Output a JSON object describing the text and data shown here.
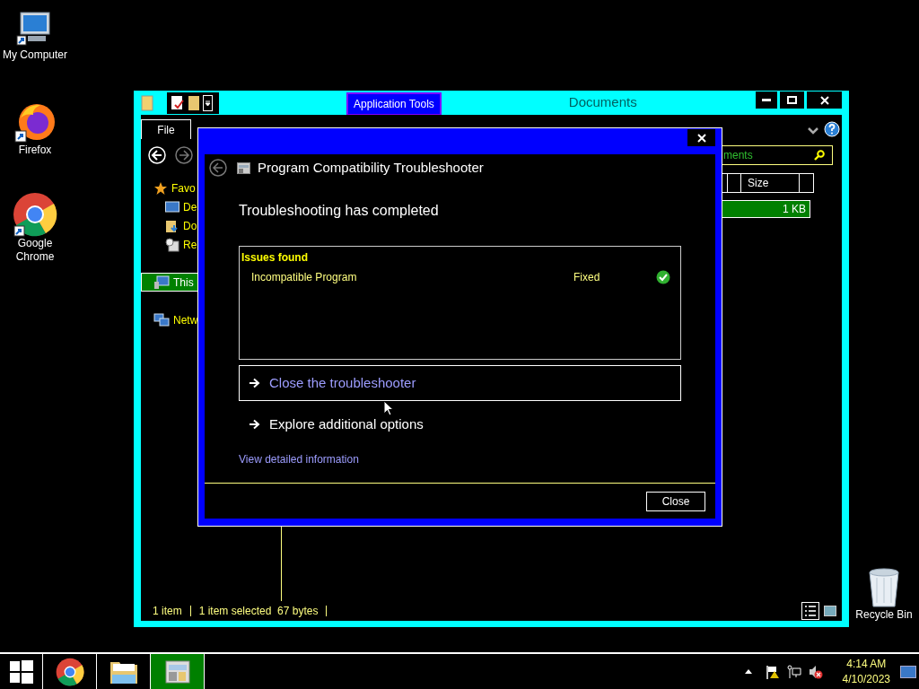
{
  "desktop_icons": [
    {
      "kind": "computer",
      "label": "My Computer"
    },
    {
      "kind": "firefox",
      "label": "Firefox"
    },
    {
      "kind": "chrome",
      "label": "Google Chrome"
    },
    {
      "kind": "recycle",
      "label": "Recycle Bin"
    }
  ],
  "explorer": {
    "title": "Documents",
    "contextual_tab": "Application Tools",
    "file_tab": "File",
    "tree": [
      {
        "kind": "favorites",
        "label": "Favo",
        "selected": false,
        "children": [
          {
            "kind": "desktop",
            "label": "De",
            "selected": false
          },
          {
            "kind": "downloads",
            "label": "Do",
            "selected": false
          },
          {
            "kind": "recent",
            "label": "Re",
            "selected": false
          }
        ]
      },
      {
        "kind": "pc",
        "label": "This",
        "selected": true
      },
      {
        "kind": "network",
        "label": "Netw",
        "selected": false
      }
    ],
    "search": {
      "placeholder": "ments"
    },
    "columns": [
      "Size"
    ],
    "rows": [
      {
        "size": "1 KB",
        "selected": true
      }
    ],
    "status": [
      "1 item",
      "1 item selected  67 bytes"
    ]
  },
  "dialog": {
    "title": "Program Compatibility Troubleshooter",
    "heading": "Troubleshooting has completed",
    "issues_title": "Issues found",
    "issues": [
      {
        "name": "Incompatible Program",
        "status": "Fixed",
        "fixed": true
      }
    ],
    "options": [
      {
        "label": "Close the troubleshooter",
        "focused": true
      },
      {
        "label": "Explore additional options",
        "focused": false
      }
    ],
    "detail_link": "View detailed information",
    "close_button": "Close"
  },
  "taskbar": {
    "apps": [
      {
        "kind": "chrome",
        "selected": false
      },
      {
        "kind": "explorer",
        "selected": false
      },
      {
        "kind": "troubleshooter",
        "selected": true
      }
    ],
    "time": "4:14 AM",
    "date": "4/10/2023"
  }
}
